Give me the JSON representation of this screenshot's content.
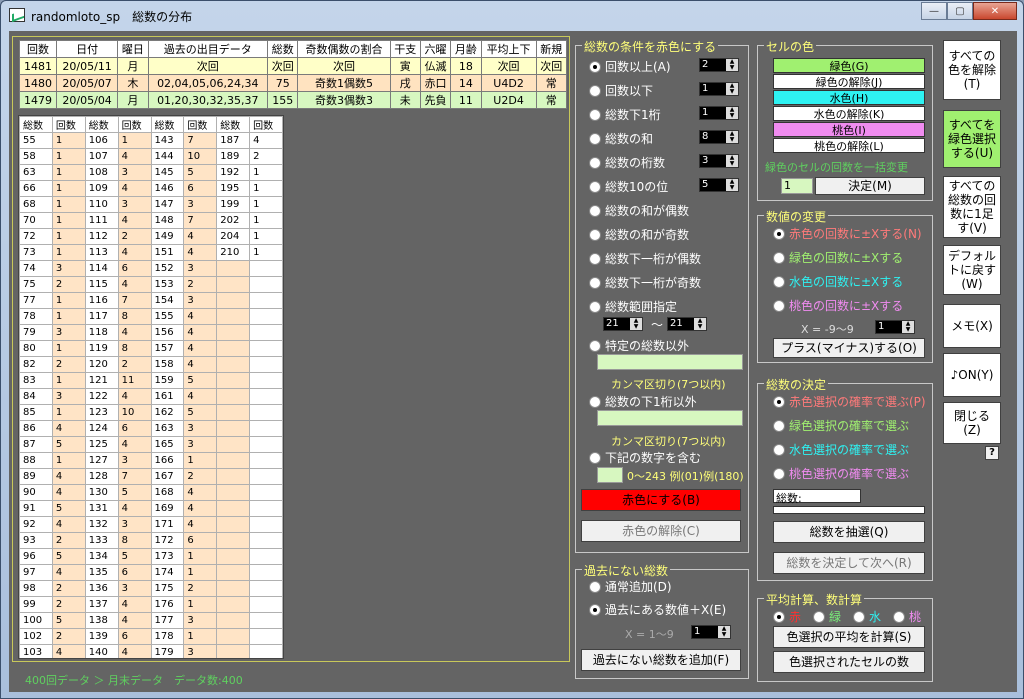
{
  "window": {
    "title": "randomloto_sp　総数の分布"
  },
  "top_table": {
    "headers": [
      "回数",
      "日付",
      "曜日",
      "過去の出目データ",
      "総数",
      "奇数偶数の割合",
      "干支",
      "六曜",
      "月齢",
      "平均上下",
      "新規"
    ],
    "rows": [
      [
        "1481",
        "20/05/11",
        "月",
        "次回",
        "次回",
        "次回",
        "寅",
        "仏滅",
        "18",
        "次回",
        "次回"
      ],
      [
        "1480",
        "20/05/07",
        "木",
        "02,04,05,06,24,34",
        "75",
        "奇数1偶数5",
        "戌",
        "赤口",
        "14",
        "U4D2",
        "常"
      ],
      [
        "1479",
        "20/05/04",
        "月",
        "01,20,30,32,35,37",
        "155",
        "奇数3偶数3",
        "未",
        "先負",
        "11",
        "U2D4",
        "常"
      ]
    ]
  },
  "dist_table": {
    "headers": [
      "総数",
      "回数",
      "総数",
      "回数",
      "総数",
      "回数",
      "総数",
      "回数"
    ],
    "col1": [
      [
        "55",
        "1"
      ],
      [
        "58",
        "1"
      ],
      [
        "63",
        "1"
      ],
      [
        "66",
        "1"
      ],
      [
        "68",
        "1"
      ],
      [
        "70",
        "1"
      ],
      [
        "72",
        "1"
      ],
      [
        "73",
        "1"
      ],
      [
        "74",
        "3"
      ],
      [
        "75",
        "2"
      ],
      [
        "77",
        "1"
      ],
      [
        "78",
        "1"
      ],
      [
        "79",
        "3"
      ],
      [
        "80",
        "1"
      ],
      [
        "82",
        "2"
      ],
      [
        "83",
        "1"
      ],
      [
        "84",
        "3"
      ],
      [
        "85",
        "1"
      ],
      [
        "86",
        "4"
      ],
      [
        "87",
        "5"
      ],
      [
        "88",
        "1"
      ],
      [
        "89",
        "4"
      ],
      [
        "90",
        "4"
      ],
      [
        "91",
        "5"
      ],
      [
        "92",
        "4"
      ],
      [
        "93",
        "2"
      ],
      [
        "96",
        "5"
      ],
      [
        "97",
        "4"
      ],
      [
        "98",
        "2"
      ],
      [
        "99",
        "2"
      ],
      [
        "100",
        "5"
      ],
      [
        "102",
        "2"
      ],
      [
        "103",
        "4"
      ],
      [
        "104",
        "6"
      ],
      [
        "105",
        "4"
      ]
    ],
    "col2": [
      [
        "106",
        "1"
      ],
      [
        "107",
        "4"
      ],
      [
        "108",
        "3"
      ],
      [
        "109",
        "4"
      ],
      [
        "110",
        "3"
      ],
      [
        "111",
        "4"
      ],
      [
        "112",
        "2"
      ],
      [
        "113",
        "4"
      ],
      [
        "114",
        "6"
      ],
      [
        "115",
        "4"
      ],
      [
        "116",
        "7"
      ],
      [
        "117",
        "8"
      ],
      [
        "118",
        "4"
      ],
      [
        "119",
        "8"
      ],
      [
        "120",
        "2"
      ],
      [
        "121",
        "11"
      ],
      [
        "122",
        "4"
      ],
      [
        "123",
        "10"
      ],
      [
        "124",
        "6"
      ],
      [
        "125",
        "4"
      ],
      [
        "127",
        "3"
      ],
      [
        "128",
        "7"
      ],
      [
        "130",
        "5"
      ],
      [
        "131",
        "4"
      ],
      [
        "132",
        "3"
      ],
      [
        "133",
        "8"
      ],
      [
        "134",
        "5"
      ],
      [
        "135",
        "6"
      ],
      [
        "136",
        "3"
      ],
      [
        "137",
        "4"
      ],
      [
        "138",
        "4"
      ],
      [
        "139",
        "6"
      ],
      [
        "140",
        "4"
      ],
      [
        "141",
        "7"
      ],
      [
        "142",
        "6"
      ]
    ],
    "col3": [
      [
        "143",
        "7"
      ],
      [
        "144",
        "10"
      ],
      [
        "145",
        "5"
      ],
      [
        "146",
        "6"
      ],
      [
        "147",
        "3"
      ],
      [
        "148",
        "7"
      ],
      [
        "149",
        "4"
      ],
      [
        "151",
        "4"
      ],
      [
        "152",
        "3"
      ],
      [
        "153",
        "2"
      ],
      [
        "154",
        "3"
      ],
      [
        "155",
        "4"
      ],
      [
        "156",
        "4"
      ],
      [
        "157",
        "4"
      ],
      [
        "158",
        "4"
      ],
      [
        "159",
        "5"
      ],
      [
        "161",
        "4"
      ],
      [
        "162",
        "5"
      ],
      [
        "163",
        "3"
      ],
      [
        "165",
        "3"
      ],
      [
        "166",
        "1"
      ],
      [
        "167",
        "2"
      ],
      [
        "168",
        "4"
      ],
      [
        "169",
        "4"
      ],
      [
        "171",
        "4"
      ],
      [
        "172",
        "6"
      ],
      [
        "173",
        "1"
      ],
      [
        "174",
        "1"
      ],
      [
        "175",
        "2"
      ],
      [
        "176",
        "1"
      ],
      [
        "177",
        "3"
      ],
      [
        "178",
        "1"
      ],
      [
        "179",
        "3"
      ],
      [
        "181",
        "1"
      ],
      [
        "184",
        "1"
      ]
    ],
    "col4": [
      [
        "187",
        "4"
      ],
      [
        "189",
        "2"
      ],
      [
        "192",
        "1"
      ],
      [
        "195",
        "1"
      ],
      [
        "199",
        "1"
      ],
      [
        "202",
        "1"
      ],
      [
        "204",
        "1"
      ],
      [
        "210",
        "1"
      ]
    ]
  },
  "status": "400回データ ＞ 月末データ　データ数:400",
  "red_condition": {
    "title": "総数の条件を赤色にする",
    "options": [
      "回数以上(A)",
      "回数以下",
      "総数下1桁",
      "総数の和",
      "総数の桁数",
      "総数10の位",
      "総数の和が偶数",
      "総数の和が奇数",
      "総数下一桁が偶数",
      "総数下一桁が奇数",
      "総数範囲指定"
    ],
    "spins": [
      "2",
      "1",
      "1",
      "8",
      "3",
      "5"
    ],
    "range_from": "21",
    "range_to": "21",
    "tilde": "〜",
    "exclude_label": "特定の総数以外",
    "comma_note1": "カンマ区切り(7つ以内)",
    "exclude_low_label": "総数の下1桁以外",
    "comma_note2": "カンマ区切り(7つ以内)",
    "contains_label": "下記の数字を含む",
    "contains_note": "0〜243 例(01)例(180)",
    "make_red": "赤色にする(B)",
    "clear_red": "赤色の解除(C)"
  },
  "cell_color": {
    "title": "セルの色",
    "buttons": [
      "緑色(G)",
      "緑色の解除(J)",
      "水色(H)",
      "水色の解除(K)",
      "桃色(I)",
      "桃色の解除(L)"
    ],
    "change_label": "緑色のセルの回数を一括変更",
    "change_value": "1",
    "confirm": "決定(M)"
  },
  "value_change": {
    "title": "数値の変更",
    "options": [
      "赤色の回数に±Xする(N)",
      "緑色の回数に±Xする",
      "水色の回数に±Xする",
      "桃色の回数に±Xする"
    ],
    "x_range": "X = -9〜9",
    "x_value": "1",
    "plusminus": "プラス(マイナス)する(O)"
  },
  "decide": {
    "title": "総数の決定",
    "options": [
      "赤色選択の確率で選ぶ(P)",
      "緑色選択の確率で選ぶ",
      "水色選択の確率で選ぶ",
      "桃色選択の確率で選ぶ"
    ],
    "total_label": "総数:",
    "draw": "総数を抽選(Q)",
    "next": "総数を決定して次へ(R)"
  },
  "past_none": {
    "title": "過去にない総数",
    "options": [
      "通常追加(D)",
      "過去にある数値＋X(E)"
    ],
    "x_range": "X = 1〜9",
    "x_value": "1",
    "add": "過去にない総数を追加(F)"
  },
  "avg": {
    "title": "平均計算、数計算",
    "options": [
      "赤",
      "緑",
      "水",
      "桃"
    ],
    "calc_avg": "色選択の平均を計算(S)",
    "count": "色選択されたセルの数"
  },
  "side": {
    "clear_all": "すべての色を解除(T)",
    "all_green": "すべてを緑色選択する(U)",
    "plus_one": "すべての総数の回数に1足す(V)",
    "default": "デフォルトに戻す(W)",
    "memo": "メモ(X)",
    "sound": "♪ON(Y)",
    "close": "閉じる(Z)",
    "help": "?"
  },
  "colors": {
    "green": "#a0f070",
    "cyan": "#2ef2f2",
    "pink": "#f08cf0",
    "red": "#ff0000",
    "yellow_text": "#ffff7a"
  }
}
